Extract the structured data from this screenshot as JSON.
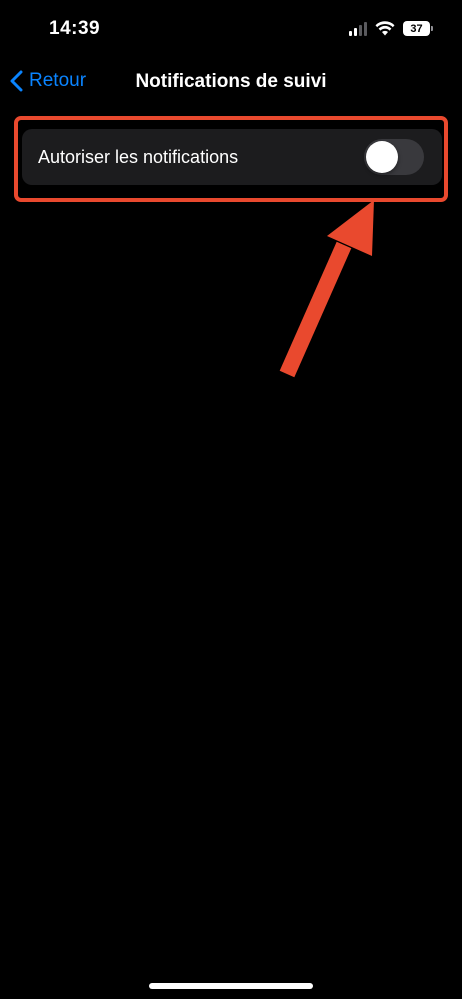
{
  "status_bar": {
    "time": "14:39",
    "battery": "37",
    "signal_icon": "cellular-signal-icon",
    "wifi_icon": "wifi-icon"
  },
  "nav": {
    "back_label": "Retour",
    "title": "Notifications de suivi"
  },
  "settings": {
    "allow_notifications_label": "Autoriser les notifications",
    "allow_notifications_on": false
  },
  "annotation": {
    "color": "#e9492e"
  },
  "colors": {
    "accent": "#0a84ff",
    "background": "#000000",
    "cell": "#1c1c1e",
    "toggle_off": "#39393d"
  }
}
